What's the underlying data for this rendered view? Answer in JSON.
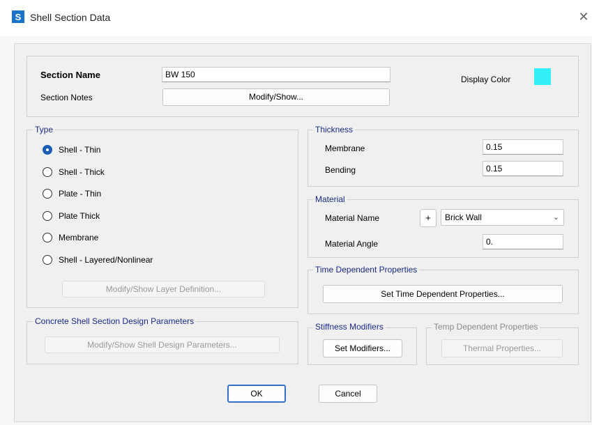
{
  "window": {
    "title": "Shell Section Data",
    "app_icon_letter": "S",
    "close_glyph": "✕"
  },
  "section": {
    "name_label": "Section Name",
    "name_value": "BW 150",
    "notes_label": "Section Notes",
    "notes_button": "Modify/Show...",
    "display_color_label": "Display Color",
    "display_color": "#33f0f8"
  },
  "type_group": {
    "title": "Type",
    "options": [
      {
        "label": "Shell - Thin",
        "selected": true
      },
      {
        "label": "Shell - Thick",
        "selected": false
      },
      {
        "label": "Plate - Thin",
        "selected": false
      },
      {
        "label": "Plate Thick",
        "selected": false
      },
      {
        "label": "Membrane",
        "selected": false
      },
      {
        "label": "Shell - Layered/Nonlinear",
        "selected": false
      }
    ],
    "layer_button": "Modify/Show Layer Definition..."
  },
  "thickness": {
    "title": "Thickness",
    "membrane_label": "Membrane",
    "membrane_value": "0.15",
    "bending_label": "Bending",
    "bending_value": "0.15"
  },
  "material": {
    "title": "Material",
    "name_label": "Material Name",
    "add_button": "+",
    "name_value": "Brick Wall",
    "angle_label": "Material Angle",
    "angle_value": "0."
  },
  "time_dependent": {
    "title": "Time Dependent Properties",
    "button": "Set Time Dependent Properties..."
  },
  "concrete_design": {
    "title": "Concrete Shell Section Design Parameters",
    "button": "Modify/Show Shell Design Parameters..."
  },
  "stiffness": {
    "title": "Stiffness Modifiers",
    "button": "Set Modifiers..."
  },
  "temp_dependent": {
    "title": "Temp Dependent Properties",
    "button": "Thermal Properties..."
  },
  "footer": {
    "ok": "OK",
    "cancel": "Cancel"
  },
  "colors": {
    "accent": "#1a5fb4",
    "group_title": "#1a2a8c"
  }
}
